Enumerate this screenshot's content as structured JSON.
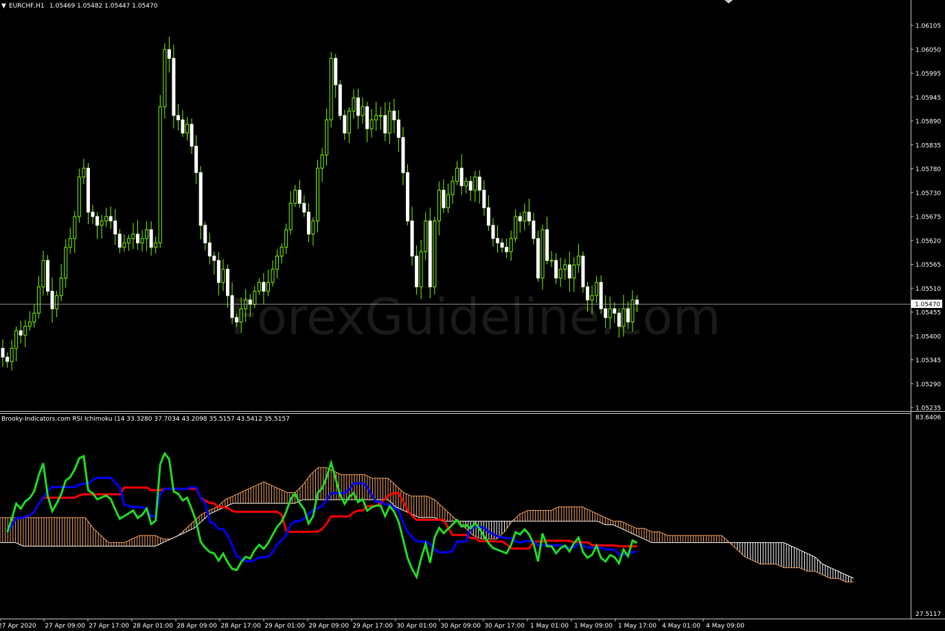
{
  "header": {
    "symbol": "EURCHF,H1",
    "ohlc": "1.05469 1.05482 1.05447 1.05470"
  },
  "watermark": "ForexGuideline.com",
  "indicator_label": "Brooky-Indicators.com RSI Ichimoku (14 33.3280 37.7034 43.2098 35.5157 43.5412 35.5157",
  "current_price_label": "1.05470",
  "colors": {
    "background": "#000000",
    "bull": "#7CFC00",
    "bear": "#FFFFFF",
    "rsi": "#22DD22",
    "tenkan": "#0000FF",
    "kijun": "#FF0000",
    "cloud_up": "#F4A460",
    "cloud_down": "#FFFFFF"
  },
  "chart_data": [
    {
      "type": "candlestick",
      "title": "EURCHF,H1",
      "ylim": [
        1.05235,
        1.0616
      ],
      "y_ticks": [
        "1.06105",
        "1.06050",
        "1.05995",
        "1.05945",
        "1.05890",
        "1.05835",
        "1.05780",
        "1.05730",
        "1.05675",
        "1.05620",
        "1.05565",
        "1.05510",
        "1.05455",
        "1.05400",
        "1.05345",
        "1.05290",
        "1.05235"
      ],
      "current_price": 1.0547,
      "close_series": [
        1.0535,
        1.0534,
        1.0537,
        1.0541,
        1.054,
        1.0542,
        1.0543,
        1.0545,
        1.0551,
        1.0557,
        1.055,
        1.0546,
        1.0549,
        1.0553,
        1.056,
        1.0562,
        1.0567,
        1.0576,
        1.0578,
        1.0568,
        1.0567,
        1.0565,
        1.0566,
        1.0567,
        1.0566,
        1.0563,
        1.056,
        1.0561,
        1.0562,
        1.0563,
        1.0561,
        1.0562,
        1.0564,
        1.056,
        1.0561,
        1.0592,
        1.0605,
        1.0603,
        1.059,
        1.0589,
        1.0586,
        1.0588,
        1.0583,
        1.0577,
        1.0565,
        1.0561,
        1.0558,
        1.0557,
        1.0552,
        1.0555,
        1.0549,
        1.0544,
        1.0543,
        1.0546,
        1.0548,
        1.0547,
        1.055,
        1.0552,
        1.055,
        1.0552,
        1.0555,
        1.0558,
        1.056,
        1.0564,
        1.057,
        1.0573,
        1.057,
        1.0568,
        1.0563,
        1.0566,
        1.0578,
        1.0581,
        1.0589,
        1.0603,
        1.0597,
        1.059,
        1.0586,
        1.0591,
        1.0594,
        1.059,
        1.0592,
        1.0587,
        1.0589,
        1.059,
        1.059,
        1.0586,
        1.0591,
        1.0589,
        1.0585,
        1.0577,
        1.0566,
        1.0558,
        1.0551,
        1.0559,
        1.0566,
        1.0551,
        1.0566,
        1.0573,
        1.0569,
        1.0572,
        1.0575,
        1.0578,
        1.0574,
        1.0575,
        1.0573,
        1.0576,
        1.0573,
        1.0569,
        1.0565,
        1.0562,
        1.0561,
        1.056,
        1.0559,
        1.0562,
        1.0567,
        1.0566,
        1.0568,
        1.0566,
        1.0562,
        1.0553,
        1.0564,
        1.0557,
        1.0557,
        1.0553,
        1.0555,
        1.0556,
        1.0553,
        1.0556,
        1.0558,
        1.0551,
        1.0548,
        1.0549,
        1.0552,
        1.0546,
        1.0544,
        1.0546,
        1.0545,
        1.0542,
        1.0546,
        1.0543,
        1.0548,
        1.0547
      ]
    },
    {
      "type": "line",
      "title": "Brooky-Indicators.com RSI Ichimoku (14 33.3280 37.7034 43.2098 35.5157 43.5412 35.5157",
      "ylim": [
        27.5117,
        83.6406
      ],
      "y_ticks": [
        "83.6406",
        "27.5117"
      ],
      "x_ticks": [
        "27 Apr 2020",
        "27 Apr 09:00",
        "27 Apr 17:00",
        "28 Apr 01:00",
        "28 Apr 09:00",
        "28 Apr 17:00",
        "29 Apr 01:00",
        "29 Apr 09:00",
        "29 Apr 17:00",
        "30 Apr 01:00",
        "30 Apr 09:00",
        "30 Apr 17:00",
        "1 May 01:00",
        "1 May 09:00",
        "1 May 17:00",
        "4 May 01:00",
        "4 May 09:00"
      ],
      "series": [],
      "cloud_span_a": [
        55,
        55,
        55,
        55,
        55,
        55,
        55,
        55,
        55,
        55,
        55,
        55,
        52,
        50,
        48,
        48,
        48,
        49,
        50,
        50,
        50,
        49,
        49,
        50,
        52,
        54,
        56,
        57,
        58,
        60,
        61,
        62,
        63,
        64,
        65,
        64,
        63,
        62,
        62,
        64,
        67,
        69,
        69,
        68,
        67,
        67,
        67,
        67,
        66,
        66,
        66,
        64,
        62,
        61,
        61,
        61,
        60,
        58,
        56,
        54,
        52,
        50,
        49,
        49,
        49,
        51,
        54,
        56,
        57,
        57,
        57,
        57,
        58,
        58,
        58,
        58,
        57,
        56,
        55,
        54,
        54,
        53,
        52,
        52,
        51,
        51,
        50,
        50,
        50,
        50,
        50,
        50,
        50,
        50,
        48,
        46,
        44,
        43,
        42,
        42,
        42,
        41,
        41,
        41,
        40,
        40,
        39,
        38,
        38,
        37,
        37
      ],
      "cloud_span_b": [
        48,
        48,
        48,
        47,
        47,
        47,
        47,
        47,
        47,
        47,
        47,
        47,
        47,
        47,
        47,
        47,
        47,
        47,
        47,
        47,
        47,
        48,
        49,
        50,
        51,
        52,
        54,
        56,
        57,
        58,
        59,
        59,
        59,
        59,
        59,
        59,
        59,
        59,
        59,
        60,
        60,
        60,
        60,
        60,
        60,
        60,
        60,
        60,
        60,
        60,
        60,
        58,
        57,
        56,
        55,
        55,
        55,
        54,
        54,
        54,
        54,
        54,
        54,
        54,
        54,
        54,
        54,
        54,
        54,
        54,
        54,
        54,
        54,
        54,
        54,
        54,
        54,
        54,
        53,
        53,
        52,
        51,
        50,
        49,
        48,
        48,
        48,
        48,
        48,
        48,
        48,
        48,
        48,
        48,
        48,
        48,
        48,
        48,
        48,
        48,
        48,
        48,
        47,
        46,
        45,
        44,
        42,
        41,
        40,
        39,
        38,
        38
      ]
    }
  ]
}
